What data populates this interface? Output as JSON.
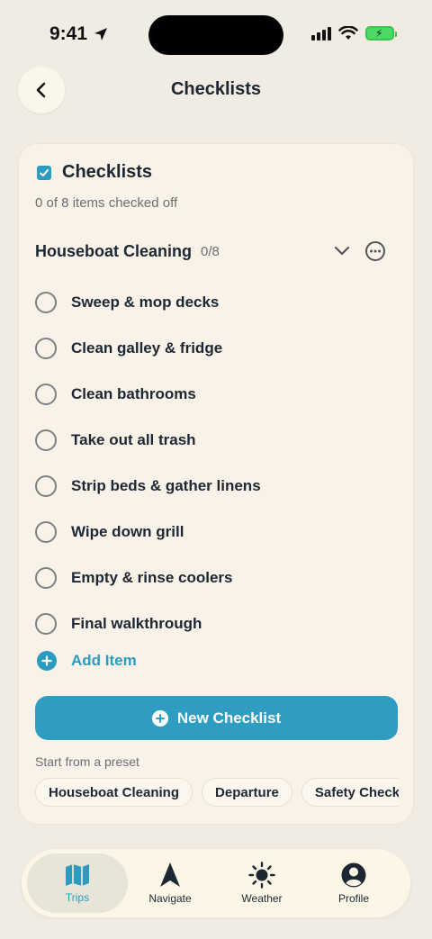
{
  "status_bar": {
    "time": "9:41"
  },
  "header": {
    "title": "Checklists"
  },
  "card": {
    "title": "Checklists",
    "subtitle": "0 of 8 items checked off",
    "group": {
      "title": "Houseboat Cleaning",
      "count": "0/8"
    },
    "items": [
      {
        "label": "Sweep & mop decks"
      },
      {
        "label": "Clean galley & fridge"
      },
      {
        "label": "Clean bathrooms"
      },
      {
        "label": "Take out all trash"
      },
      {
        "label": "Strip beds & gather linens"
      },
      {
        "label": "Wipe down grill"
      },
      {
        "label": "Empty & rinse coolers"
      },
      {
        "label": "Final walkthrough"
      }
    ],
    "add_item_label": "Add Item",
    "new_checklist_label": "New Checklist",
    "preset_label": "Start from a preset",
    "presets": [
      "Houseboat Cleaning",
      "Departure",
      "Safety Check"
    ]
  },
  "tabs": [
    {
      "label": "Trips",
      "icon": "map-icon",
      "active": true
    },
    {
      "label": "Navigate",
      "icon": "navigation-arrow-icon",
      "active": false
    },
    {
      "label": "Weather",
      "icon": "sun-icon",
      "active": false
    },
    {
      "label": "Profile",
      "icon": "person-icon",
      "active": false
    }
  ],
  "colors": {
    "accent": "#2B9CC0",
    "background": "#F1ECE3",
    "card": "#F8F2E8"
  }
}
